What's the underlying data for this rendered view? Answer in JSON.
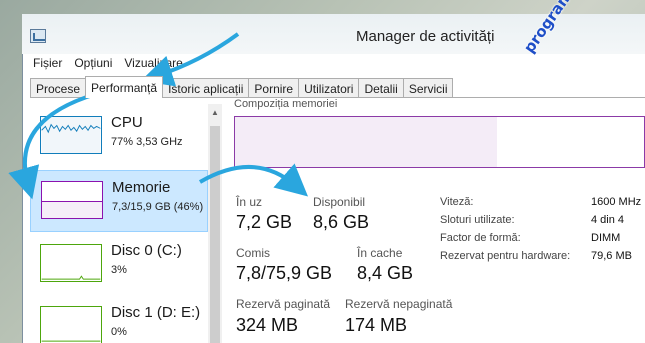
{
  "window": {
    "title": "Manager de activități"
  },
  "menu": {
    "items": [
      "Fișier",
      "Opțiuni",
      "Vizualizare"
    ]
  },
  "tabs": [
    "Procese",
    "Performanță",
    "Istoric aplicații",
    "Pornire",
    "Utilizatori",
    "Detalii",
    "Servicii"
  ],
  "active_tab": "Performanță",
  "sidebar": {
    "items": [
      {
        "title": "CPU",
        "subtitle": "77% 3,53 GHz",
        "color": "#117dbb"
      },
      {
        "title": "Memorie",
        "subtitle": "7,3/15,9 GB (46%)",
        "color": "#8b12ae"
      },
      {
        "title": "Disc 0 (C:)",
        "subtitle": "3%",
        "color": "#4da60c"
      },
      {
        "title": "Disc 1 (D: E:)",
        "subtitle": "0%",
        "color": "#4da60c"
      }
    ]
  },
  "memory": {
    "composition_label": "Compoziția memoriei",
    "used_fraction": 0.46,
    "stats": {
      "in_use_label": "În uz",
      "in_use": "7,2 GB",
      "available_label": "Disponibil",
      "available": "8,6 GB",
      "committed_label": "Comis",
      "committed": "7,8/75,9 GB",
      "cached_label": "În cache",
      "cached": "8,4 GB",
      "paged_label": "Rezervă paginată",
      "paged": "324 MB",
      "nonpaged_label": "Rezervă nepaginată",
      "nonpaged": "174 MB"
    },
    "details": [
      {
        "key": "Viteză:",
        "value": "1600 MHz"
      },
      {
        "key": "Sloturi utilizate:",
        "value": "4 din 4"
      },
      {
        "key": "Factor de formă:",
        "value": "DIMM"
      },
      {
        "key": "Rezervat pentru hardware:",
        "value": "79,6 MB"
      }
    ]
  },
  "watermark": "programecalculator.ro",
  "colors": {
    "accent_arrow": "#2aa6de",
    "memory": "#8b3aa7",
    "selected_bg": "#cce8ff"
  }
}
